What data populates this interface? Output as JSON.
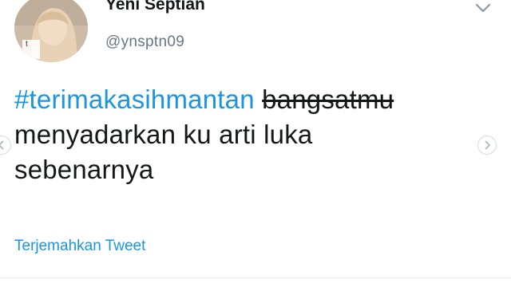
{
  "tweet": {
    "display_name": "Yeni Septian",
    "handle": "@ynsptn09",
    "hashtag": "#terimakasihmantan",
    "struck_word": "bangsatmu",
    "line2": "menyadarkan ku arti luka",
    "line3": "sebenarnya",
    "translate_label": "Terjemahkan Tweet",
    "avatar_caption": "t"
  },
  "icons": {
    "menu": "chevron-down-icon",
    "prev": "chevron-left-icon",
    "next": "chevron-right-icon"
  },
  "colors": {
    "link": "#1b95e0",
    "text": "#14171a",
    "secondary": "#657786"
  }
}
